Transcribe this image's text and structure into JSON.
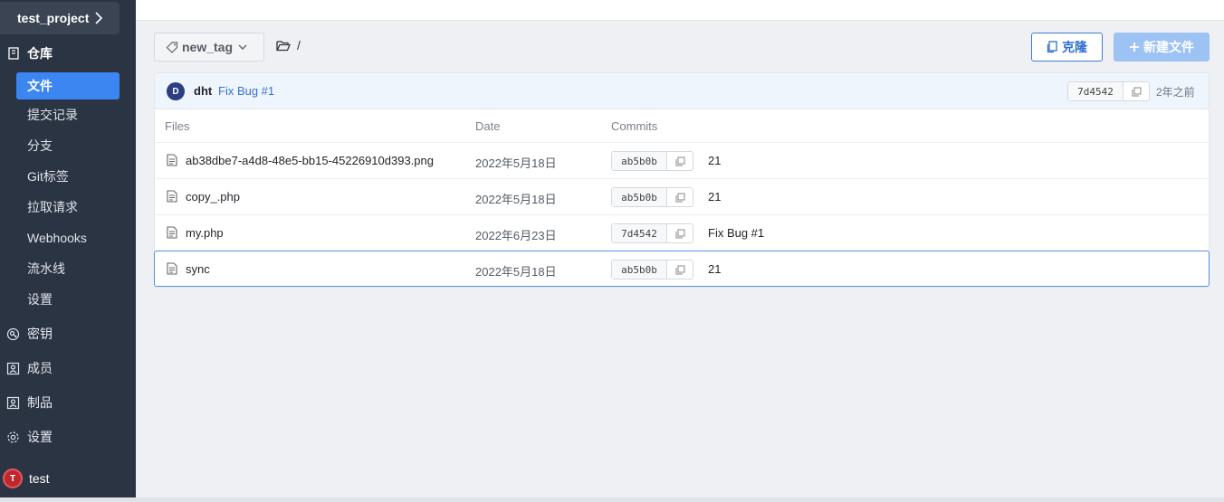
{
  "sidebar": {
    "project": "test_project",
    "section_repo": "仓库",
    "repo_items": [
      {
        "label": "文件",
        "active": true
      },
      {
        "label": "提交记录"
      },
      {
        "label": "分支"
      },
      {
        "label": "Git标签"
      },
      {
        "label": "拉取请求"
      },
      {
        "label": "Webhooks"
      },
      {
        "label": "流水线"
      },
      {
        "label": "设置"
      }
    ],
    "top_items": [
      {
        "label": "密钥",
        "icon": "key-icon"
      },
      {
        "label": "成员",
        "icon": "members-icon"
      },
      {
        "label": "制品",
        "icon": "artifacts-icon"
      },
      {
        "label": "设置",
        "icon": "gear-icon"
      }
    ],
    "user": {
      "initial": "T",
      "name": "test"
    }
  },
  "toolbar": {
    "tag": "new_tag",
    "path": "/",
    "clone_label": "克隆",
    "new_file_label": "新建文件"
  },
  "latest_commit": {
    "avatar_initial": "D",
    "author": "dht",
    "message": "Fix Bug #1",
    "hash": "7d4542",
    "time": "2年之前"
  },
  "table": {
    "headers": [
      "Files",
      "Date",
      "Commits"
    ],
    "rows": [
      {
        "name": "ab38dbe7-a4d8-48e5-bb15-45226910d393.png",
        "date": "2022年5月18日",
        "hash": "ab5b0b",
        "message": "21"
      },
      {
        "name": "copy_.php",
        "date": "2022年5月18日",
        "hash": "ab5b0b",
        "message": "21"
      },
      {
        "name": "my.php",
        "date": "2022年6月23日",
        "hash": "7d4542",
        "message": "Fix Bug #1"
      },
      {
        "name": "sync",
        "date": "2022年5月18日",
        "hash": "ab5b0b",
        "message": "21"
      }
    ]
  },
  "colors": {
    "sidebar_bg": "#2b3443",
    "accent": "#3c86f2",
    "link": "#3573d4"
  }
}
